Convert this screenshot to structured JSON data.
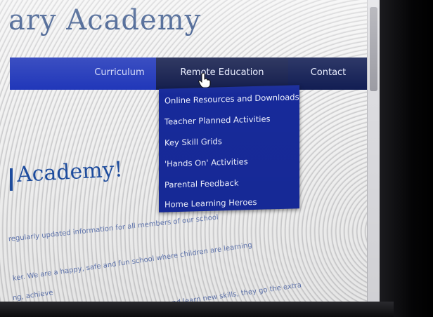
{
  "site": {
    "title": "ary Academy",
    "welcome": "Academy!"
  },
  "nav": {
    "items": [
      {
        "label": "Curriculum"
      },
      {
        "label": "Remote Education"
      },
      {
        "label": "Contact"
      }
    ]
  },
  "dropdown": {
    "items": [
      "Online Resources and Downloads",
      "Teacher Planned Activities",
      "Key Skill Grids",
      "'Hands On' Activities",
      "Parental Feedback",
      "Home Learning Heroes"
    ]
  },
  "content": {
    "lines": [
      "regularly updated information for all members of our school",
      "ker. We are a happy, safe and fun school where children are learning",
      "ng, achieve",
      "rning and learn new skills, they go the extra"
    ]
  },
  "colors": {
    "nav_bg": "#0d1950",
    "nav_active": "#1c33b8",
    "dropdown_bg": "#172a9a",
    "title": "#1e3f7a"
  }
}
